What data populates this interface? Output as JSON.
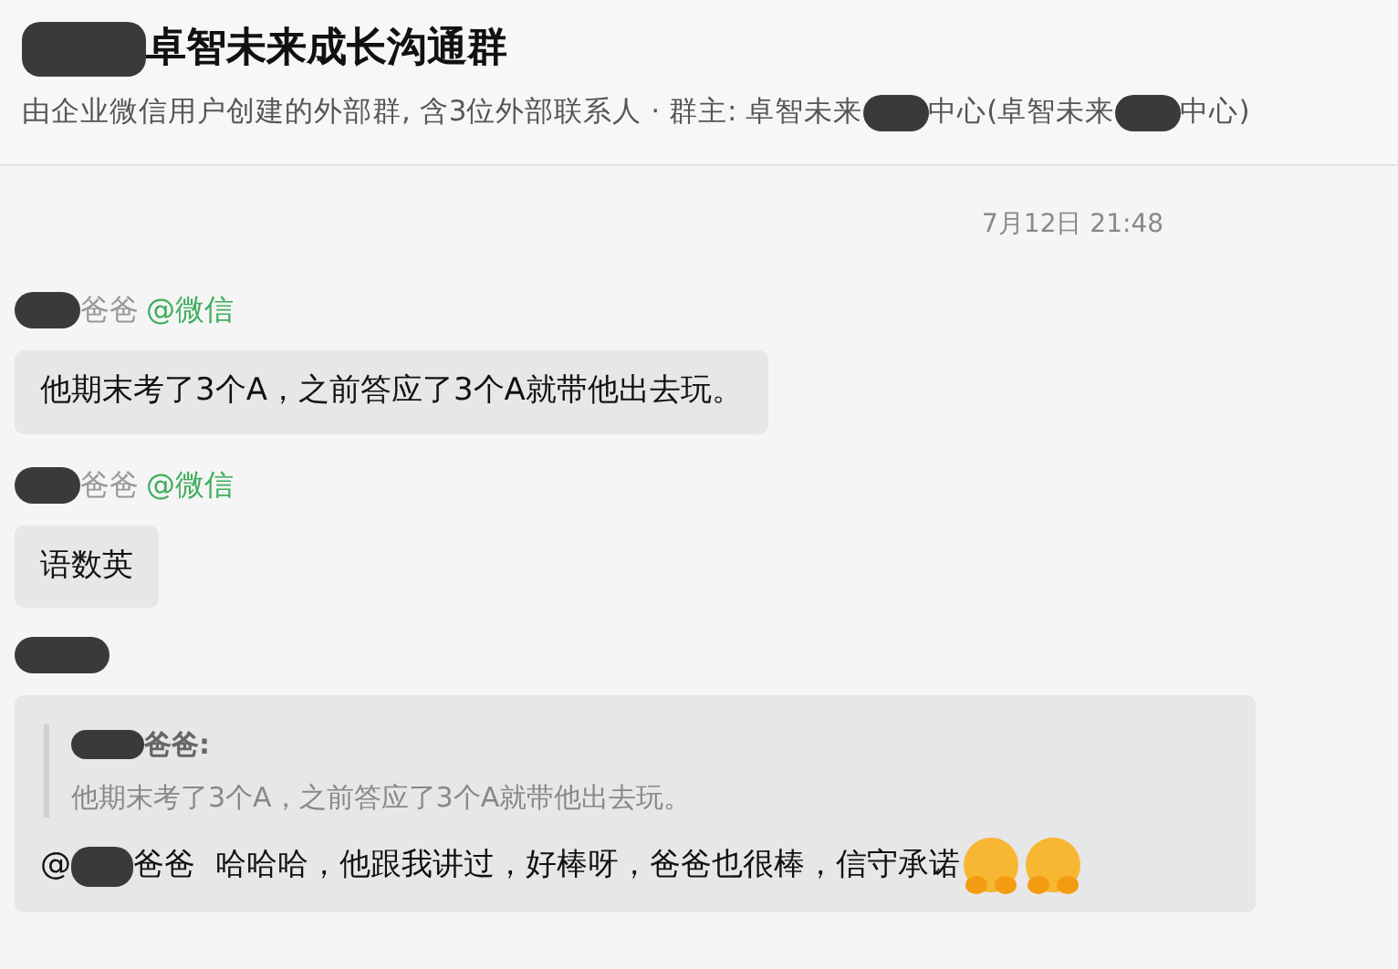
{
  "header": {
    "title": [
      {
        "kind": "redacted"
      },
      {
        "kind": "text",
        "text": "卓智未来成长沟通群"
      }
    ],
    "subtitle": [
      {
        "kind": "text",
        "text": "由企业微信用户创建的外部群, 含3位外部联系人 · 群主: 卓智未来"
      },
      {
        "kind": "redacted"
      },
      {
        "kind": "text",
        "text": "中心(卓智未来"
      },
      {
        "kind": "redacted"
      },
      {
        "kind": "text",
        "text": "中心)"
      }
    ]
  },
  "timestamp": "7月12日 21:48",
  "messages": [
    {
      "sender": [
        {
          "kind": "redacted"
        },
        {
          "kind": "text",
          "text": "爸爸"
        }
      ],
      "source": "@微信",
      "body": [
        {
          "kind": "text",
          "text": "他期末考了3个A，之前答应了3个A就带他出去玩。"
        }
      ]
    },
    {
      "sender": [
        {
          "kind": "redacted"
        },
        {
          "kind": "text",
          "text": "爸爸"
        }
      ],
      "source": "@微信",
      "body": [
        {
          "kind": "text",
          "text": "语数英"
        }
      ]
    },
    {
      "sender": [
        {
          "kind": "redacted"
        }
      ],
      "quote": {
        "author": [
          {
            "kind": "redacted"
          },
          {
            "kind": "text",
            "text": "爸爸:"
          }
        ],
        "text": "他期末考了3个A，之前答应了3个A就带他出去玩。"
      },
      "body": [
        {
          "kind": "text",
          "text": "@"
        },
        {
          "kind": "redacted"
        },
        {
          "kind": "text",
          "text": "爸爸  哈哈哈，他跟我讲过，好棒呀，爸爸也很棒，信守承诺"
        },
        {
          "kind": "emoji"
        },
        {
          "kind": "emoji"
        }
      ]
    }
  ]
}
